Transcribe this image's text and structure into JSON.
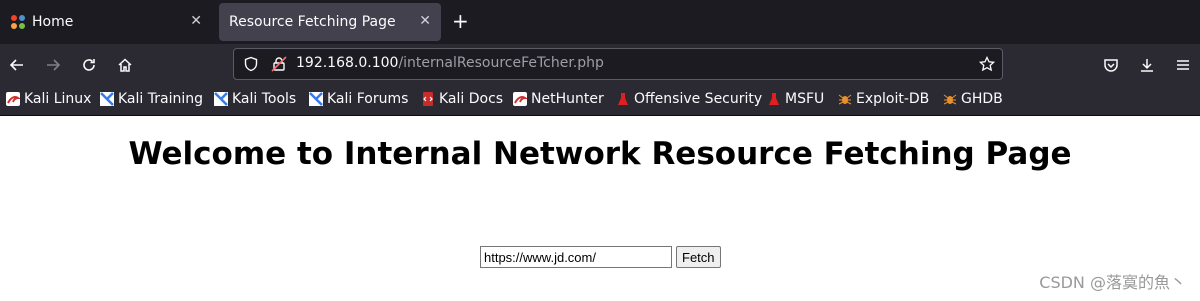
{
  "tabs": [
    {
      "label": "Home",
      "active": false
    },
    {
      "label": "Resource Fetching Page",
      "active": true
    }
  ],
  "urlbar": {
    "host": "192.168.0.100",
    "path": "/internalResourceFeTcher.php"
  },
  "bookmarks": [
    {
      "label": "Kali Linux",
      "icon": "kali-dragon-icon"
    },
    {
      "label": "Kali Training",
      "icon": "kali-training-icon"
    },
    {
      "label": "Kali Tools",
      "icon": "kali-tools-icon"
    },
    {
      "label": "Kali Forums",
      "icon": "kali-forums-icon"
    },
    {
      "label": "Kali Docs",
      "icon": "kali-docs-icon"
    },
    {
      "label": "NetHunter",
      "icon": "nethunter-icon"
    },
    {
      "label": "Offensive Security",
      "icon": "offsec-icon"
    },
    {
      "label": "MSFU",
      "icon": "msfu-icon"
    },
    {
      "label": "Exploit-DB",
      "icon": "exploitdb-icon"
    },
    {
      "label": "GHDB",
      "icon": "ghdb-icon"
    }
  ],
  "page": {
    "heading": "Welcome to Internal Network Resource Fetching Page",
    "url_value": "https://www.jd.com/",
    "fetch_label": "Fetch"
  },
  "watermark": "CSDN @落寞的魚丶",
  "colors": {
    "tabbar": "#1c1b22",
    "navbar": "#2b2a33",
    "active_tab": "#42414d"
  }
}
